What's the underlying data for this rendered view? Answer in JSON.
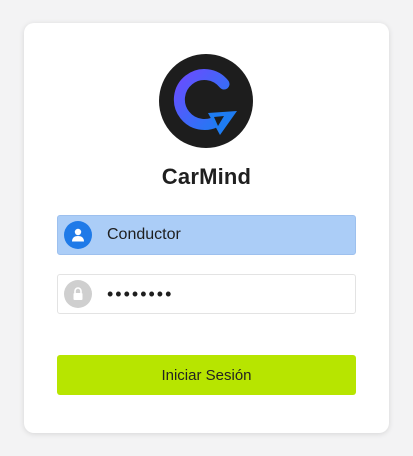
{
  "app": {
    "name": "CarMind"
  },
  "login": {
    "username_value": "Conductor",
    "password_value": "12345678",
    "submit_label": "Iniciar Sesión"
  },
  "icons": {
    "logo": "carmind-logo-icon",
    "user": "user-icon",
    "password": "lock-icon"
  },
  "colors": {
    "accent": "#b7e500",
    "user_field_bg": "#abcdf7",
    "user_icon_bg": "#1f7ae8",
    "logo_bg": "#1d1d1d",
    "logo_blue": "#2f6ff5"
  }
}
